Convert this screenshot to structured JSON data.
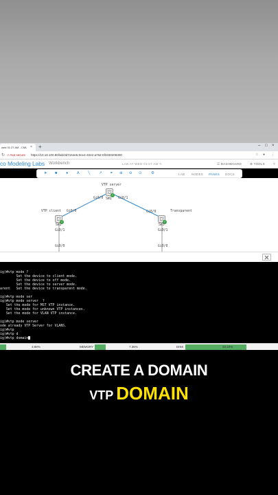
{
  "browser": {
    "tab_title": "wed 01:27 AM - CML",
    "new_tab": "+",
    "security_warning": "Not secure",
    "url": "https://10.10.100.80/lab/3d7154e5-0ce4-4042-a762-6f3330208300"
  },
  "app": {
    "brand": "co Modeling Labs",
    "workbench": "Workbench",
    "lab_title": "LAB AT WED 01:27 AM",
    "dashboard": "DASHBOARD",
    "tools": "TOOLS",
    "help": "?"
  },
  "toolbar": {
    "tabs": [
      "LAB",
      "NODES",
      "PANES",
      "DOCS"
    ],
    "active_tab": "PANES"
  },
  "topology": {
    "nodes": [
      {
        "label": "VTP server",
        "name": "SW1"
      },
      {
        "label": "VTP client",
        "name": "SW2"
      },
      {
        "label": "Transparent",
        "name": "SW3"
      }
    ],
    "ifaces": {
      "sw1_left": "Gi0/0",
      "sw1_right": "Gi0/1",
      "sw2_top": "Gi0/0",
      "sw2_bottom": "Gi0/1",
      "sw2_bottom2": "Gi0/0",
      "sw3_top": "Gi0/0",
      "sw3_bottom": "Gi0/1",
      "sw3_side": "Gi0/0"
    }
  },
  "terminal": {
    "lines": [
      "ig)#vtp mode ?",
      "        Set the device to client mode.",
      "        Set the device to off mode.",
      "        Set the device to server mode.",
      "arent   Set the device to transparent mode.",
      "",
      "ig)#vtp mode ser",
      "ig)#vtp mode server  ?",
      "   Set the mode for MST VTP instance.",
      "   Set the mode for unknown VTP instances.",
      "   Set the mode for VLAN VTP instance.",
      "",
      "ig)#vtp mode server",
      "ode already VTP Server for VLANS.",
      "ig)#vtp",
      "ig)#vtp d",
      "ig)#vtp domain"
    ]
  },
  "statusbar": {
    "cpu_value": "3.88%",
    "memory_label": "MEMORY",
    "memory_value": "7.36%",
    "disk_label": "DISK",
    "disk_value": "33.22%",
    "cpu_fraction": 0.04,
    "memory_fraction": 0.07,
    "disk_fraction": 0.33,
    "fill_color": "#3aa04a"
  },
  "captions": {
    "line1": "CREATE A DOMAIN",
    "line2_prefix": "VTP",
    "line2_highlight": "DOMAIN",
    "highlight_color": "#ffe100"
  }
}
